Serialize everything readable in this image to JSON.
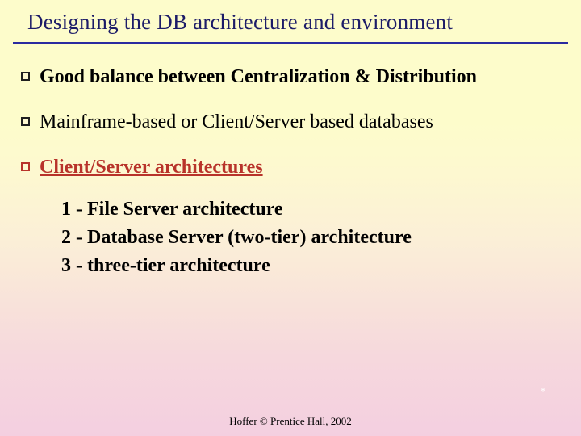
{
  "title": "Designing the DB architecture and environment",
  "bullets": [
    {
      "text": "Good balance between Centralization & Distribution",
      "style": "bold"
    },
    {
      "text": "Mainframe-based or Client/Server based databases",
      "style": "plain"
    },
    {
      "text": "Client/Server architectures",
      "style": "client"
    }
  ],
  "sublist": [
    "1 - File Server architecture",
    "2 - Database Server (two-tier) architecture",
    "3 - three-tier architecture"
  ],
  "footer": "Hoffer © Prentice Hall, 2002",
  "page_marker": "*"
}
